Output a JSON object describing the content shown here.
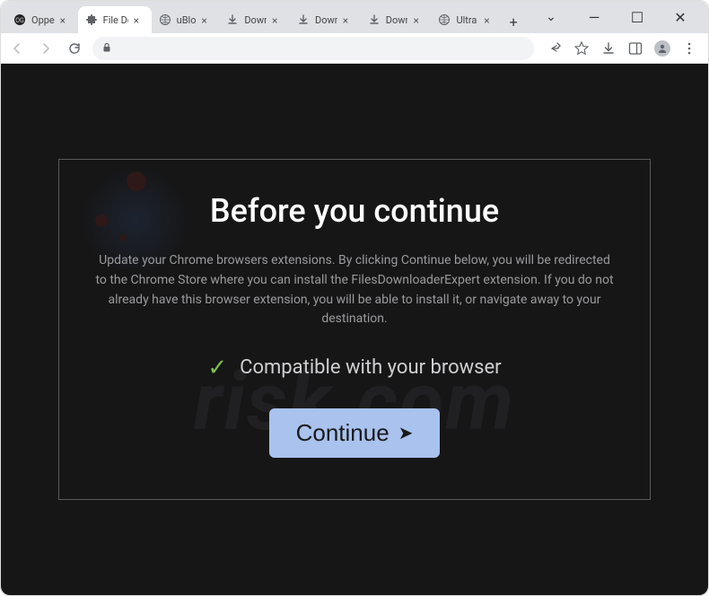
{
  "window": {
    "tabs": [
      {
        "title": "Oppenh",
        "favicon": "circle-dark"
      },
      {
        "title": "File Dow",
        "favicon": "puzzle",
        "active": true
      },
      {
        "title": "uBlock",
        "favicon": "globe"
      },
      {
        "title": "Downlo",
        "favicon": "download"
      },
      {
        "title": "Downlo",
        "favicon": "download"
      },
      {
        "title": "Downlo",
        "favicon": "download"
      },
      {
        "title": "Ultra va",
        "favicon": "globe"
      }
    ],
    "controls": {
      "dropdown": "⌄",
      "minimize": "—",
      "maximize": "☐",
      "close": "✕"
    }
  },
  "toolbar": {
    "urlValue": ""
  },
  "modal": {
    "title": "Before you continue",
    "body": "Update your Chrome browsers extensions. By clicking Continue below, you will be redirected to the Chrome Store where you can install the FilesDownloaderExpert extension. If you do not already have this browser extension, you will be able to install it, or navigate away to your destination.",
    "compatible": "Compatible with your browser",
    "button": "Continue",
    "buttonArrow": "➤"
  },
  "watermark": "risk.com"
}
